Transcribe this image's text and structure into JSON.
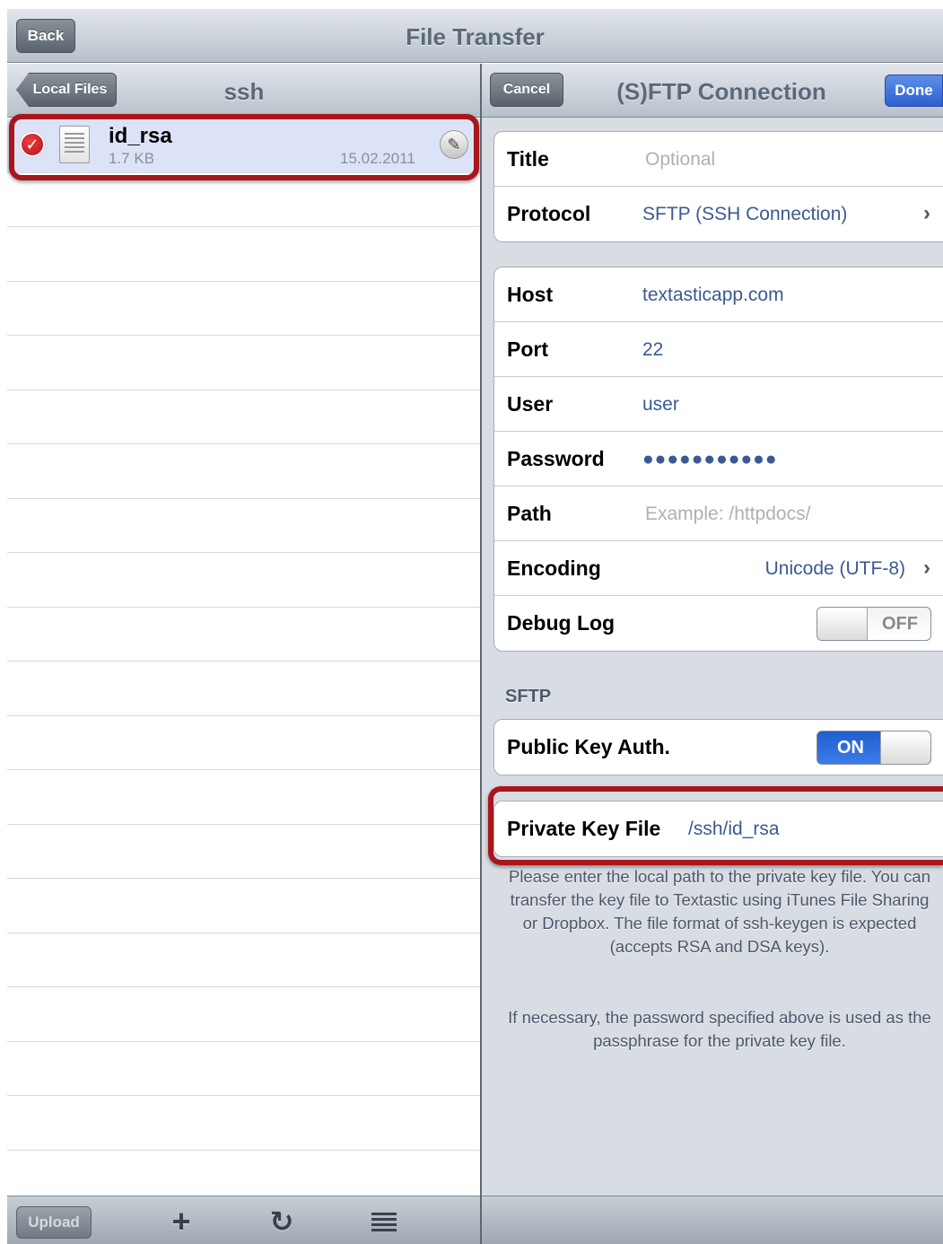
{
  "topbar": {
    "title": "File Transfer",
    "back_label": "Back"
  },
  "left": {
    "nav_title": "ssh",
    "back_label": "Local Files",
    "files": [
      {
        "name": "id_rsa",
        "size": "1.7 KB",
        "date": "15.02.2011",
        "selected": true
      }
    ],
    "toolbar": {
      "upload_label": "Upload",
      "icons": [
        "plus-icon",
        "refresh-icon",
        "list-icon"
      ]
    }
  },
  "right": {
    "nav_title": "(S)FTP Connection",
    "cancel_label": "Cancel",
    "done_label": "Done",
    "group1": {
      "title_label": "Title",
      "title_placeholder": "Optional",
      "protocol_label": "Protocol",
      "protocol_value": "SFTP (SSH Connection)"
    },
    "group2": {
      "host_label": "Host",
      "host_value": "textasticapp.com",
      "port_label": "Port",
      "port_value": "22",
      "user_label": "User",
      "user_value": "user",
      "password_label": "Password",
      "password_value": "●●●●●●●●●●●",
      "path_label": "Path",
      "path_placeholder": "Example: /httpdocs/",
      "encoding_label": "Encoding",
      "encoding_value": "Unicode (UTF-8)",
      "debug_label": "Debug Log",
      "debug_state": "OFF"
    },
    "sftp": {
      "section_header": "SFTP",
      "pubkey_label": "Public Key Auth.",
      "pubkey_state": "ON",
      "keyfile_label": "Private Key File",
      "keyfile_value": "/ssh/id_rsa",
      "help1": "Please enter the local path to the private key file. You can transfer the key file to Textastic using iTunes File Sharing or Dropbox. The file format of ssh-keygen is expected (accepts RSA and DSA keys).",
      "help2": "If necessary, the password specified above is used as the passphrase for the private key file."
    }
  },
  "colors": {
    "highlight": "#a8161b",
    "done_blue": "#2d5fd1",
    "value_blue": "#3b5a92",
    "switch_on": "#1f5ed1"
  }
}
